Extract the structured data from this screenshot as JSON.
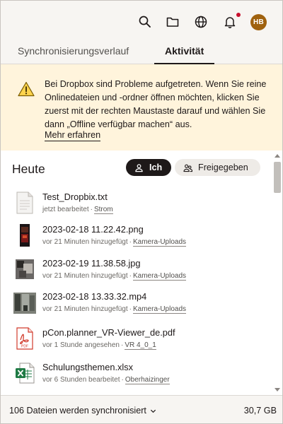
{
  "header": {
    "icons": [
      "search-icon",
      "folder-icon",
      "globe-icon",
      "bell-icon"
    ],
    "avatar_initials": "HB",
    "accent": "#a0620f",
    "notification_dot_color": "#c8102e"
  },
  "tabs": [
    {
      "label": "Synchronisierungsverlauf",
      "active": false
    },
    {
      "label": "Aktivität",
      "active": true
    }
  ],
  "banner": {
    "text": "Bei Dropbox sind Probleme aufgetreten. Wenn Sie reine Onlinedateien und -ordner öffnen möchten, klicken Sie zuerst mit der rechten Maustaste darauf und wählen Sie dann „Offline verfügbar machen“ aus.",
    "link": "Mehr erfahren",
    "icon": "warning-icon",
    "background": "#fff4dc"
  },
  "main": {
    "heading": "Heute",
    "filters": {
      "me": "Ich",
      "shared": "Freigegeben"
    },
    "files": [
      {
        "name": "Test_Dropbix.txt",
        "status": "jetzt bearbeitet",
        "location": "Strom",
        "type": "txt"
      },
      {
        "name": "2023-02-18 11.22.42.png",
        "status": "vor 21 Minuten hinzugefügt",
        "location": "Kamera-Uploads",
        "type": "image-dark"
      },
      {
        "name": "2023-02-19 11.38.58.jpg",
        "status": "vor 21 Minuten hinzugefügt",
        "location": "Kamera-Uploads",
        "type": "image-grey"
      },
      {
        "name": "2023-02-18 13.33.32.mp4",
        "status": "vor 21 Minuten hinzugefügt",
        "location": "Kamera-Uploads",
        "type": "video"
      },
      {
        "name": "pCon.planner_VR-Viewer_de.pdf",
        "status": "vor 1 Stunde angesehen",
        "location": "VR 4_0_1",
        "type": "pdf"
      },
      {
        "name": "Schulungsthemen.xlsx",
        "status": "vor 6 Stunden bearbeitet",
        "location": "Oberhaizinger",
        "type": "xlsx"
      }
    ]
  },
  "footer": {
    "status": "106 Dateien werden synchronisiert",
    "size": "30,7 GB"
  }
}
